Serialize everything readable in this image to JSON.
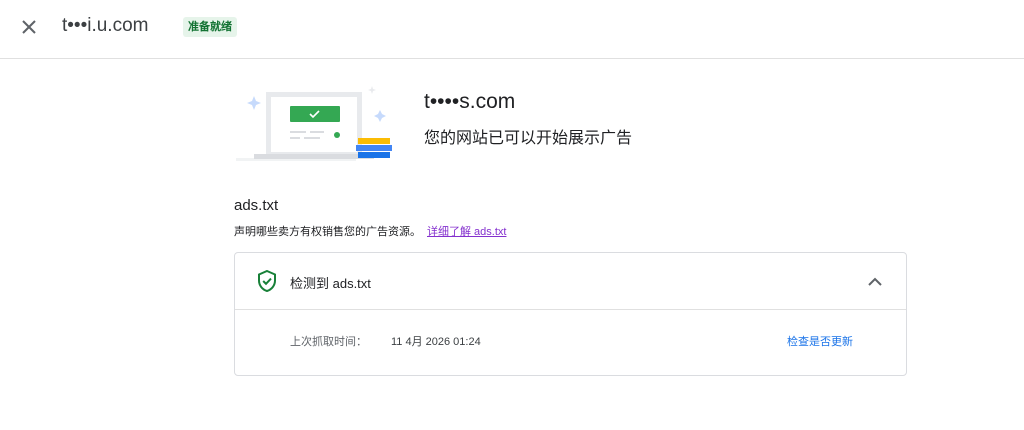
{
  "topbar": {
    "close_icon": "close-icon",
    "site_title": "t•••i.u.com",
    "status_badge": "准备就绪",
    "badge_bg": "#e6f4ea",
    "badge_fg": "#137333"
  },
  "hero": {
    "domain": "t••••s.com",
    "subtitle": "您的网站已可以开始展示广告"
  },
  "ads_txt": {
    "title": "ads.txt",
    "description": "声明哪些卖方有权销售您的广告资源。",
    "learn_more": "详细了解 ads.txt",
    "link_color": "#8430ce"
  },
  "card": {
    "status_icon": "shield-check-icon",
    "status_color": "#188038",
    "title": "检测到 ads.txt",
    "toggle_icon": "chevron-up-icon",
    "fetch_label": "上次抓取时间：",
    "fetch_value": "11 4月 2026 01:24",
    "check_updates": "检查是否更新",
    "action_color": "#1a73e8"
  }
}
